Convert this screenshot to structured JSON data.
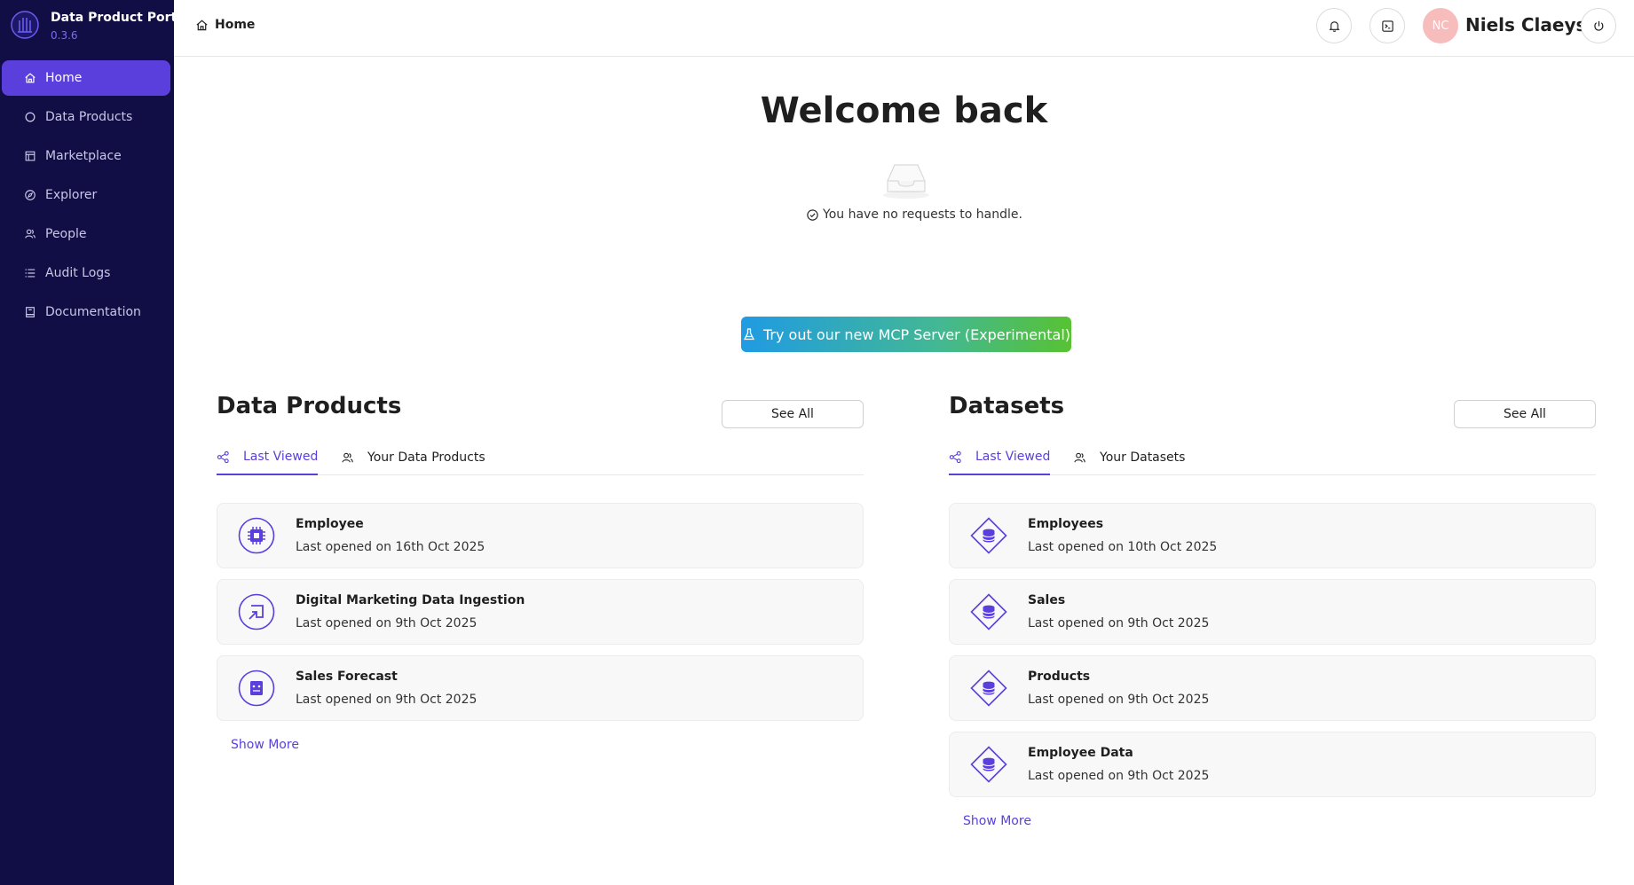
{
  "brand": {
    "name": "Data Product Portal",
    "version": "0.3.6"
  },
  "sidebar": {
    "items": [
      {
        "label": "Home",
        "icon": "home-icon"
      },
      {
        "label": "Data Products",
        "icon": "circle-icon"
      },
      {
        "label": "Marketplace",
        "icon": "shop-icon"
      },
      {
        "label": "Explorer",
        "icon": "compass-icon"
      },
      {
        "label": "People",
        "icon": "people-icon"
      },
      {
        "label": "Audit Logs",
        "icon": "list-icon"
      },
      {
        "label": "Documentation",
        "icon": "book-icon"
      }
    ]
  },
  "header": {
    "breadcrumb": "Home",
    "user": {
      "initials": "NC",
      "name": "Niels Claeys"
    }
  },
  "main": {
    "welcome": "Welcome back",
    "no_requests": "You have no requests to handle.",
    "mcp_button": "Try out our new MCP Server (Experimental)"
  },
  "data_products": {
    "title": "Data Products",
    "see_all": "See All",
    "tabs": [
      "Last Viewed",
      "Your Data Products"
    ],
    "items": [
      {
        "name": "Employee",
        "opened": "Last opened on 16th Oct 2025",
        "icon": "chip-icon"
      },
      {
        "name": "Digital Marketing Data Ingestion",
        "opened": "Last opened on 9th Oct 2025",
        "icon": "import-icon"
      },
      {
        "name": "Sales Forecast",
        "opened": "Last opened on 9th Oct 2025",
        "icon": "robot-icon"
      }
    ],
    "show_more": "Show More"
  },
  "datasets": {
    "title": "Datasets",
    "see_all": "See All",
    "tabs": [
      "Last Viewed",
      "Your Datasets"
    ],
    "items": [
      {
        "name": "Employees",
        "opened": "Last opened on 10th Oct 2025",
        "icon": "dataset-icon"
      },
      {
        "name": "Sales",
        "opened": "Last opened on 9th Oct 2025",
        "icon": "dataset-icon"
      },
      {
        "name": "Products",
        "opened": "Last opened on 9th Oct 2025",
        "icon": "dataset-icon"
      },
      {
        "name": "Employee Data",
        "opened": "Last opened on 9th Oct 2025",
        "icon": "dataset-icon"
      }
    ],
    "show_more": "Show More"
  },
  "colors": {
    "sidebar_bg": "#110d45",
    "accent": "#5b3fdc",
    "avatar_bg": "#f7bcbc"
  }
}
